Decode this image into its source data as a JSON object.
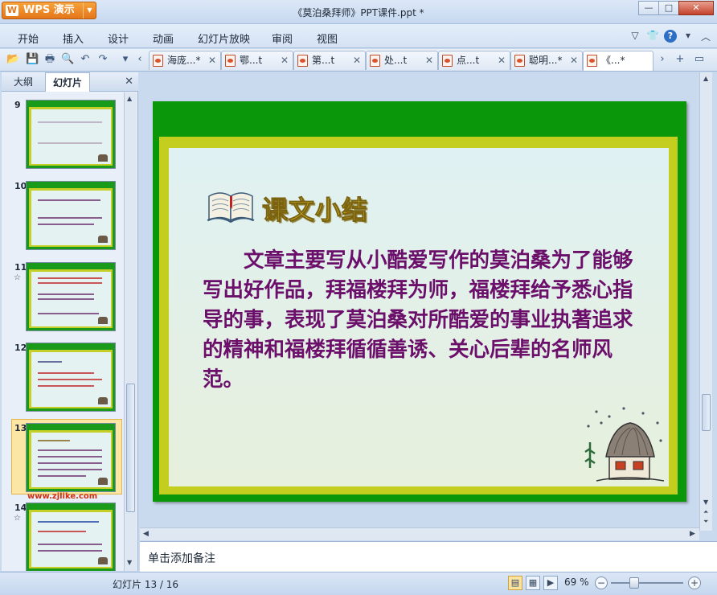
{
  "app": {
    "brand_label": "WPS 演示",
    "window_title": "《莫泊桑拜师》PPT课件.ppt *"
  },
  "menu": [
    "开始",
    "插入",
    "设计",
    "动画",
    "幻灯片放映",
    "审阅",
    "视图"
  ],
  "doc_tabs": [
    {
      "label": "海庞...*",
      "active": false
    },
    {
      "label": "鄂...t",
      "active": false
    },
    {
      "label": "第...t",
      "active": false
    },
    {
      "label": "处...t",
      "active": false
    },
    {
      "label": "点...t",
      "active": false
    },
    {
      "label": "聪明...*",
      "active": false
    },
    {
      "label": "《...*",
      "active": true
    }
  ],
  "left_panel": {
    "tabs": [
      "大纲",
      "幻灯片"
    ],
    "active_tab": "幻灯片",
    "slides": [
      {
        "num": "9",
        "star": false
      },
      {
        "num": "10",
        "star": false
      },
      {
        "num": "11",
        "star": true
      },
      {
        "num": "12",
        "star": false
      },
      {
        "num": "13",
        "star": false,
        "selected": true
      },
      {
        "num": "14",
        "star": true
      }
    ],
    "star_glyph": "☆"
  },
  "slide": {
    "title": "课文小结",
    "body": "文章主要写从小酷爱写作的莫泊桑为了能够写出好作品，拜福楼拜为师，福楼拜给予悉心指导的事，表现了莫泊桑对所酷爱的事业执著追求的精神和福楼拜循循善诱、关心后辈的名师风范。",
    "colors": {
      "frame": "#0a980a",
      "band": "#c3ce1f",
      "title": "#f2d528",
      "body": "#6b0f6b"
    }
  },
  "watermark": "www.zjlike.com",
  "notes_placeholder": "单击添加备注",
  "status": {
    "slide_indicator": "幻灯片 13 / 16",
    "zoom": "69 %",
    "zoom_level_percent": 69
  },
  "icons": {
    "minimize": "—",
    "maximize": "□",
    "close": "✕",
    "tab_close": "✕",
    "help": "?"
  }
}
